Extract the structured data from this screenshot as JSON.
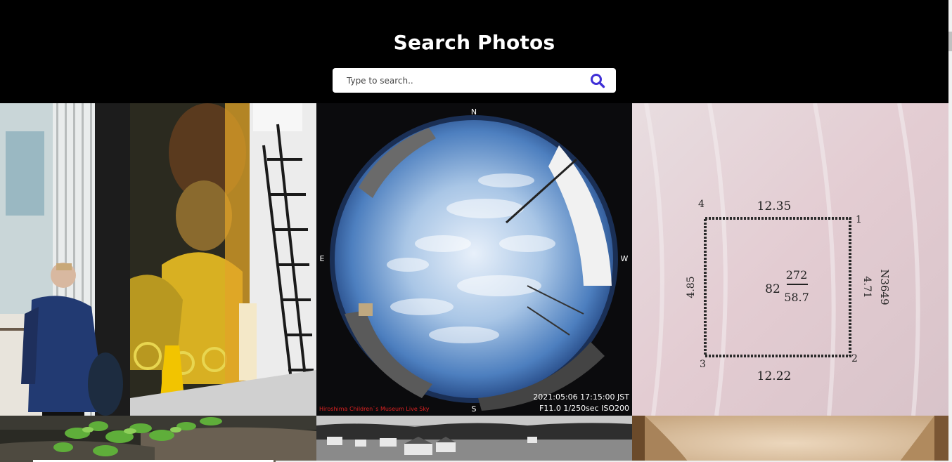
{
  "page": {
    "title": "Search Photos"
  },
  "search": {
    "placeholder": "Type to search..",
    "value": "",
    "icon": "search-icon",
    "accent": "#3f2fd6"
  },
  "photos": [
    {
      "name": "street-mural-photo"
    },
    {
      "name": "fisheye-sky-photo",
      "compass": {
        "n": "N",
        "s": "S",
        "e": "E",
        "w": "W"
      },
      "caption_left": "Hiroshima Children`s Museum Live Sky",
      "caption_right_1": "2021:05:06 17:15:00 JST",
      "caption_right_2": "F11.0 1/250sec ISO200"
    },
    {
      "name": "land-plot-document-photo",
      "labels": {
        "top": "12.35",
        "bottom": "12.22",
        "left": "4.85",
        "right": "4.71",
        "c1": "1",
        "c2": "2",
        "c3": "3",
        "c4": "4",
        "lot": "82",
        "frac_top": "272",
        "frac_bot": "58.7",
        "side": "N3649"
      }
    },
    {
      "name": "plants-on-rock-photo"
    },
    {
      "name": "black-white-village-photo"
    },
    {
      "name": "beige-interior-photo"
    }
  ]
}
